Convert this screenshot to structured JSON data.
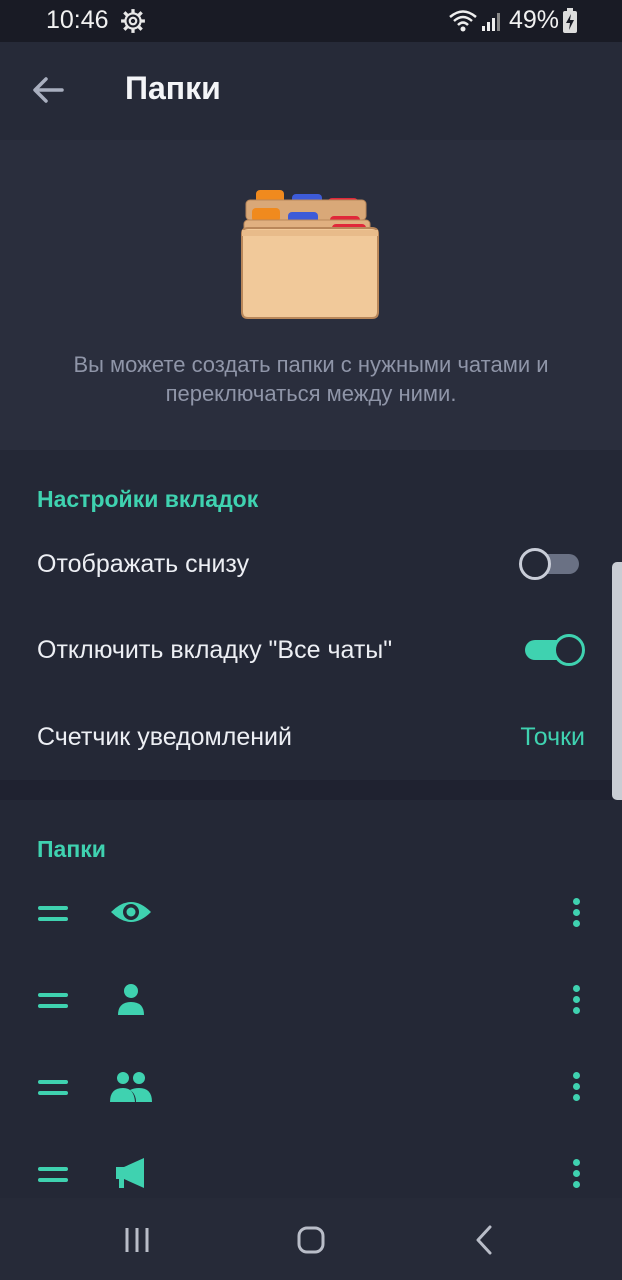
{
  "status_bar": {
    "time": "10:46",
    "battery": "49%",
    "icons": [
      "gear-icon",
      "wifi-icon",
      "signal-icon",
      "battery-charging-icon"
    ]
  },
  "app_bar": {
    "title": "Папки",
    "back_icon": "arrow-left-icon"
  },
  "hero": {
    "image": "folders-illustration",
    "description": "Вы можете создать папки с нужными чатами и переключаться между ними."
  },
  "tab_settings": {
    "header": "Настройки вкладок",
    "rows": [
      {
        "label": "Отображать снизу",
        "type": "switch",
        "checked": false
      },
      {
        "label": "Отключить вкладку \"Все чаты\"",
        "type": "switch",
        "checked": true
      },
      {
        "label": "Счетчик уведомлений",
        "type": "value",
        "value": "Точки"
      }
    ]
  },
  "folders": {
    "header": "Папки",
    "items": [
      {
        "icon": "eye-icon"
      },
      {
        "icon": "person-icon"
      },
      {
        "icon": "people-icon"
      },
      {
        "icon": "megaphone-icon"
      }
    ]
  },
  "navigation": {
    "buttons": [
      "recent-apps-icon",
      "home-icon",
      "back-icon"
    ]
  },
  "colors": {
    "accent": "#3fd2b0",
    "background": "#1f2230",
    "surface": "#242836",
    "app_bar": "#262a38",
    "hero": "#2a2e3d"
  }
}
